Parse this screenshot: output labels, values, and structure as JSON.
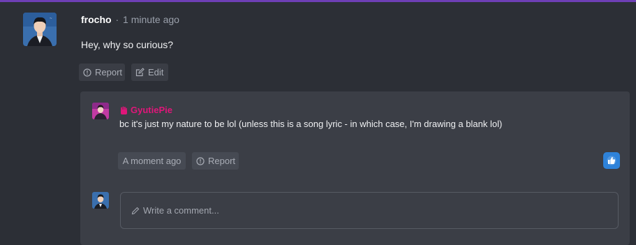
{
  "post": {
    "author": "frocho",
    "separator": "·",
    "time": "1 minute ago",
    "body": "Hey, why so curious?",
    "report_label": "Report",
    "edit_label": "Edit"
  },
  "reply": {
    "author": "GyutiePie",
    "author_icon": "hand-icon",
    "body": "bc it's just my nature to be lol (unless this is a song lyric - in which case, I'm drawing a blank lol)",
    "time": "A moment ago",
    "report_label": "Report",
    "like_icon": "thumbs-up-icon"
  },
  "comment": {
    "placeholder": "Write a comment..."
  },
  "colors": {
    "accent_bar": "#6e3fb5",
    "reply_author": "#e0167a",
    "like": "#2e82d9"
  }
}
